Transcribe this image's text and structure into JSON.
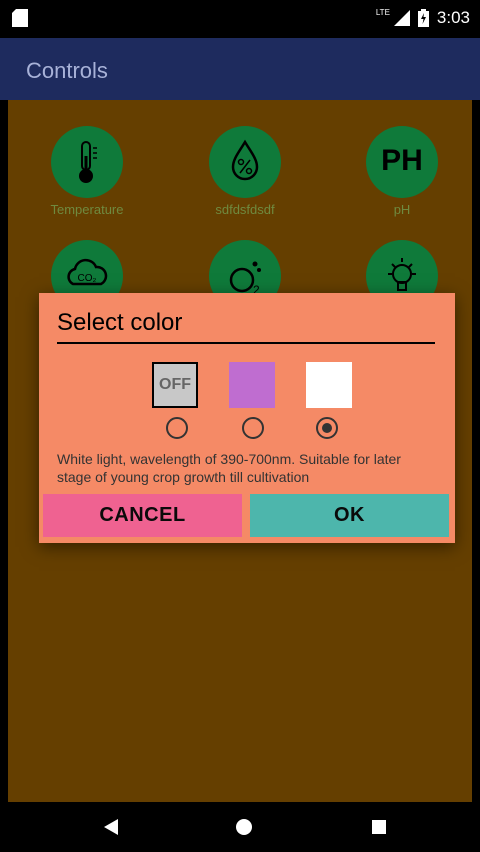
{
  "status_bar": {
    "network": "LTE",
    "time": "3:03"
  },
  "app_bar": {
    "title": "Controls"
  },
  "tiles": [
    {
      "label": "Temperature",
      "icon": "thermometer-icon"
    },
    {
      "label": "sdfdsfdsdf",
      "icon": "humidity-drop-icon"
    },
    {
      "label": "pH",
      "icon_text": "PH"
    },
    {
      "label": "",
      "icon": "co2-cloud-icon"
    },
    {
      "label": "",
      "icon": "oxygen-icon"
    },
    {
      "label": "",
      "icon": "light-bulb-icon"
    }
  ],
  "dialog": {
    "title": "Select color",
    "options": [
      {
        "label": "OFF",
        "color": "#c8c8c8",
        "selected": false
      },
      {
        "label": "",
        "color": "#bf6dd0",
        "selected": false
      },
      {
        "label": "",
        "color": "#ffffff",
        "selected": true
      }
    ],
    "description": "White light, wavelength of 390-700nm. Suitable for later stage of young crop growth till cultivation",
    "cancel_label": "CANCEL",
    "ok_label": "OK"
  },
  "colors": {
    "app_bar": "#1e2b5e",
    "background": "#653f00",
    "dialog": "#f58a66",
    "cancel": "#ef6291",
    "ok": "#4db6ac",
    "icon_circle": "#0f7a3a"
  }
}
